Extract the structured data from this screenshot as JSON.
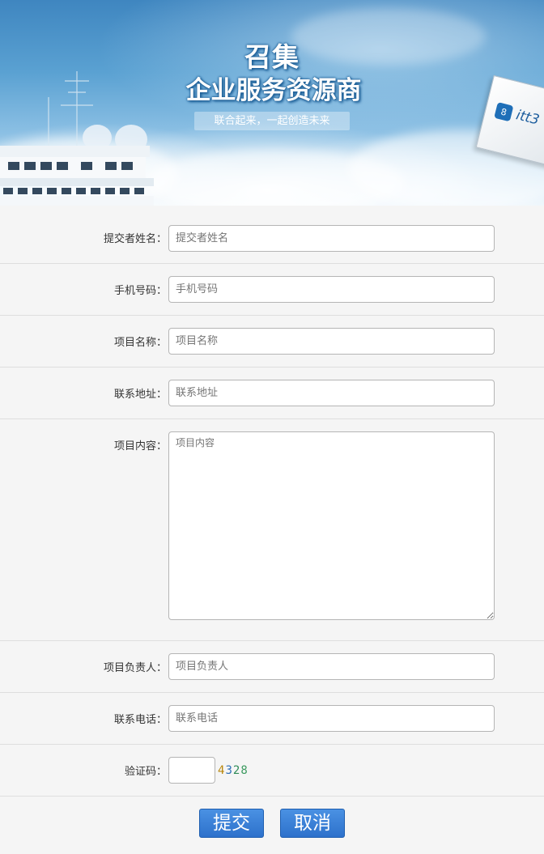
{
  "banner": {
    "title_line1": "召集",
    "title_line2": "企业服务资源商",
    "slogan": "联合起来，一起创造未来",
    "brand_logo_text": "itt3",
    "colors": {
      "title_outline": "#1c5e96",
      "sky": "#5aa1d2"
    }
  },
  "form": {
    "fields": [
      {
        "label": "提交者姓名：",
        "placeholder": "提交者姓名",
        "value": ""
      },
      {
        "label": "手机号码：",
        "placeholder": "手机号码",
        "value": ""
      },
      {
        "label": "项目名称：",
        "placeholder": "项目名称",
        "value": ""
      },
      {
        "label": "联系地址：",
        "placeholder": "联系地址",
        "value": ""
      },
      {
        "label": "项目内容：",
        "placeholder": "项目内容",
        "value": ""
      },
      {
        "label": "项目负责人：",
        "placeholder": "项目负责人",
        "value": ""
      },
      {
        "label": "联系电话：",
        "placeholder": "联系电话",
        "value": ""
      }
    ],
    "captcha": {
      "label": "验证码：",
      "value": "",
      "digits": [
        {
          "char": "4",
          "color": "#b8860b"
        },
        {
          "char": "3",
          "color": "#2e6fb8"
        },
        {
          "char": "2",
          "color": "#2e8b57"
        },
        {
          "char": "8",
          "color": "#3c9a5f"
        }
      ]
    },
    "buttons": {
      "submit": "提交",
      "cancel": "取消",
      "color": "#2d71cb"
    }
  }
}
